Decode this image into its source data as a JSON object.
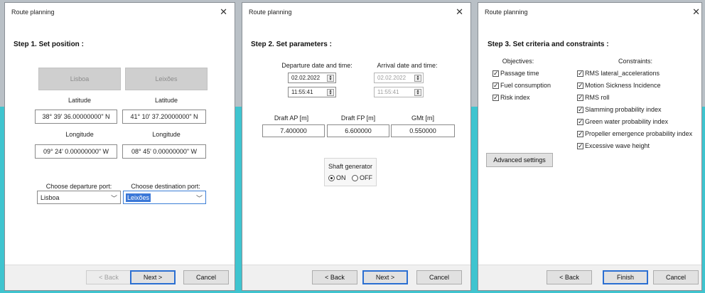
{
  "dialog1": {
    "title": "Route planning",
    "close_glyph": "✕",
    "step": "Step 1. Set position :",
    "port_btn_left": "Lisboa",
    "port_btn_right": "Leixões",
    "lat_label": "Latitude",
    "lon_label": "Longitude",
    "dep_lat": "38° 39' 36.00000000\" N",
    "dest_lat": "41° 10' 37.20000000\" N",
    "dep_lon": "09° 24' 0.00000000\" W",
    "dest_lon": "08° 45' 0.00000000\" W",
    "dep_port_label": "Choose departure port:",
    "dest_port_label": "Choose destination port:",
    "dep_port_value": "Lisboa",
    "dest_port_value": "Leixões",
    "back": "< Back",
    "next": "Next >",
    "cancel": "Cancel"
  },
  "dialog2": {
    "title": "Route planning",
    "close_glyph": "✕",
    "step": "Step 2. Set parameters :",
    "departure_label": "Departure date and time:",
    "arrival_label": "Arrival date and time:",
    "dep_date": "02.02.2022",
    "dep_time": "11:55:41",
    "arr_date": "02.02.2022",
    "arr_time": "11:55:41",
    "spin_glyph": "▲▼",
    "draft_ap_label": "Draft AP [m]",
    "draft_fp_label": "Draft FP [m]",
    "gmt_label": "GMt [m]",
    "draft_ap": "7.400000",
    "draft_fp": "6.600000",
    "gmt": "0.550000",
    "shaft_label": "Shaft generator",
    "on": "ON",
    "off": "OFF",
    "back": "< Back",
    "next": "Next >",
    "cancel": "Cancel"
  },
  "dialog3": {
    "title": "Route planning",
    "close_glyph": "✕",
    "step": "Step 3. Set criteria and constraints :",
    "objectives_label": "Objectives:",
    "constraints_label": "Constraints:",
    "objectives": [
      "Passage time",
      "Fuel consumption",
      "Risk index"
    ],
    "constraints": [
      "RMS lateral_accelerations",
      "Motion Sickness Incidence",
      "RMS roll",
      "Slamming probability index",
      "Green water probability index",
      "Propeller emergence probability index",
      "Excessive wave height"
    ],
    "advanced": "Advanced settings",
    "back": "< Back",
    "finish": "Finish",
    "cancel": "Cancel"
  },
  "colors": {
    "accent": "#2b6fd2",
    "teal_background": "#3fc4cf"
  }
}
